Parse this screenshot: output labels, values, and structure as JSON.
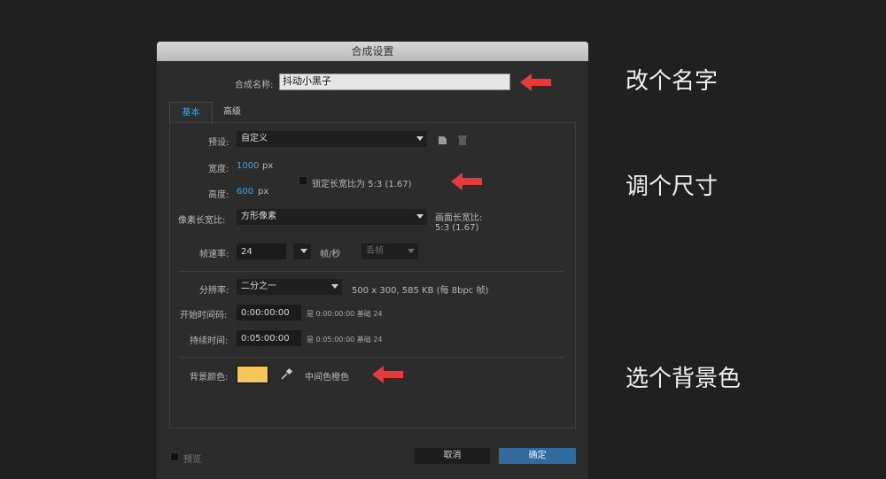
{
  "dialog": {
    "title": "合成设置",
    "comp_name_label": "合成名称:",
    "comp_name_value": "抖动小黑子",
    "tabs": [
      {
        "label": "基本"
      },
      {
        "label": "高级"
      }
    ],
    "preset": {
      "label": "预设:",
      "value": "自定义"
    },
    "width": {
      "label": "宽度:",
      "value": "1000",
      "unit": "px"
    },
    "height": {
      "label": "高度:",
      "value": "600",
      "unit": "px"
    },
    "lock_ratio": {
      "label": "锁定长宽比为 5:3 (1.67)",
      "checked": false
    },
    "pixel_aspect": {
      "label": "像素长宽比:",
      "value": "方形像素"
    },
    "frame_aspect": {
      "label": "画面长宽比:",
      "value": "5:3 (1.67)"
    },
    "frame_rate": {
      "label": "帧速率:",
      "value": "24",
      "unit": "帧/秒",
      "drop_frame": "丢帧"
    },
    "resolution": {
      "label": "分辨率:",
      "value": "二分之一",
      "info": "500 x 300, 585 KB (每 8bpc 帧)"
    },
    "start_timecode": {
      "label": "开始时间码:",
      "value": "0:00:00:00",
      "info": "是 0:00:00:00 基础 24"
    },
    "duration": {
      "label": "持续时间:",
      "value": "0:05:00:00",
      "info": "是 0:05:00:00 基础 24"
    },
    "bg_color": {
      "label": "背景颜色:",
      "swatch": "#f5c65a",
      "name": "中间色橙色"
    },
    "preview_label": "预览",
    "cancel_label": "取消",
    "ok_label": "确定"
  },
  "annotations": {
    "rename": "改个名字",
    "resize": "调个尺寸",
    "bgcolor": "选个背景色"
  },
  "colors": {
    "background": "#202020",
    "dialog": "#2c2c2c",
    "accent": "#4f9fd9",
    "arrow": "#e63b3b",
    "primary_button": "#2f6b9c"
  },
  "icons": [
    "new-preset-icon",
    "trash-icon",
    "eyedropper-icon",
    "chevron-down-icon",
    "red-arrow-icon"
  ]
}
